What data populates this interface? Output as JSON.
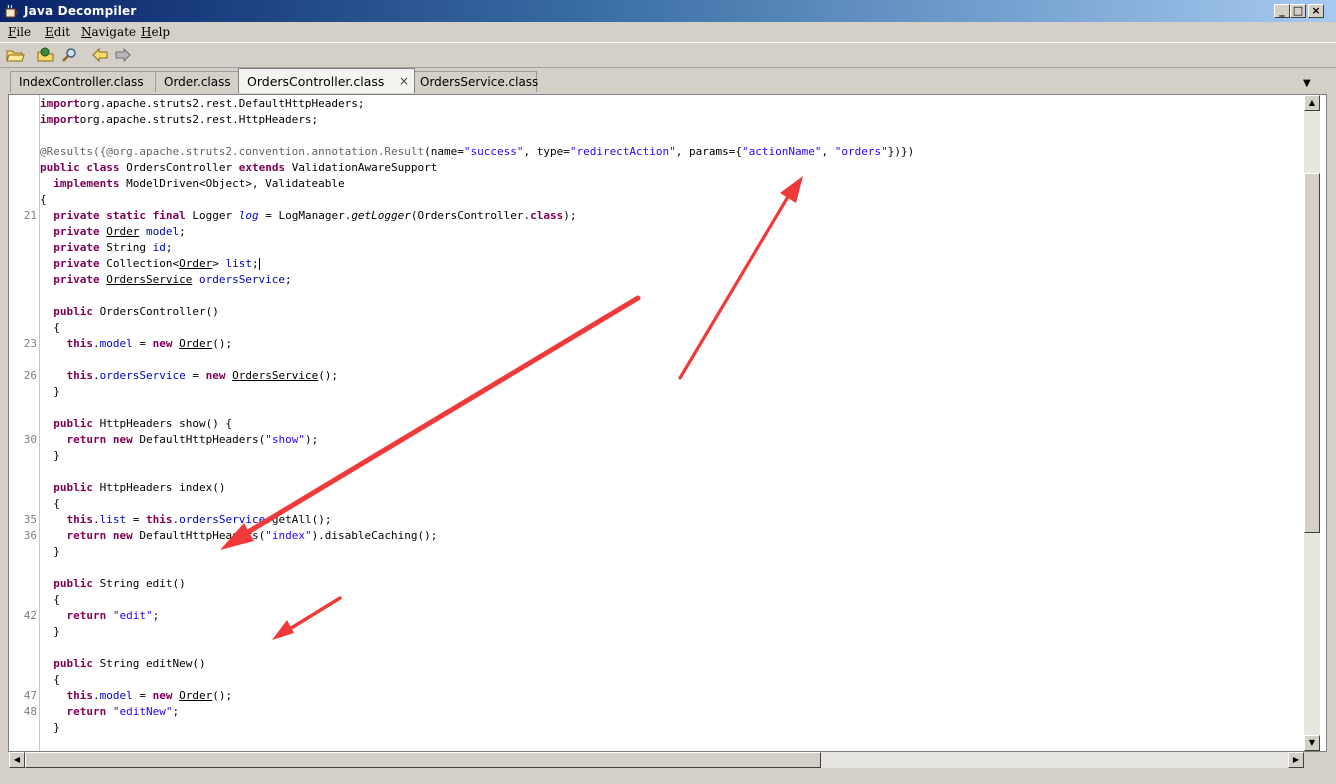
{
  "window": {
    "title": "Java Decompiler",
    "minimize_glyph": "_",
    "maximize_glyph": "□",
    "close_glyph": "×"
  },
  "menubar": [
    {
      "accel": "F",
      "rest": "ile"
    },
    {
      "accel": "E",
      "rest": "dit"
    },
    {
      "accel": "N",
      "rest": "avigate"
    },
    {
      "accel": "H",
      "rest": "elp"
    }
  ],
  "toolbar": {
    "icons": [
      "open-folder-icon",
      "open-type-icon",
      "search-icon",
      "back-icon",
      "forward-icon"
    ]
  },
  "tabs": [
    {
      "label": "IndexController.class",
      "active": false
    },
    {
      "label": "Order.class",
      "active": false
    },
    {
      "label": "OrdersController.class",
      "active": true,
      "close": "×"
    },
    {
      "label": "OrdersService.class",
      "active": false
    }
  ],
  "tab_menu_glyph": "▼",
  "code": {
    "line_numbers": [
      {
        "row": 7,
        "num": "21"
      },
      {
        "row": 15,
        "num": "23"
      },
      {
        "row": 17,
        "num": "26"
      },
      {
        "row": 21,
        "num": "30"
      },
      {
        "row": 26,
        "num": "35"
      },
      {
        "row": 27,
        "num": "36"
      },
      {
        "row": 32,
        "num": "42"
      },
      {
        "row": 37,
        "num": "47"
      },
      {
        "row": 38,
        "num": "48"
      }
    ],
    "lines": [
      [
        [
          "kw",
          "import"
        ],
        [
          "",
          "org.apache.struts2.rest.DefaultHttpHeaders;"
        ]
      ],
      [
        [
          "kw",
          "import"
        ],
        [
          "",
          "org.apache.struts2.rest.HttpHeaders;"
        ]
      ],
      [],
      [
        [
          "ann",
          "@Results({@org.apache.struts2.convention.annotation.Result"
        ],
        [
          "",
          "(name="
        ],
        [
          "str",
          "\"success\""
        ],
        [
          "",
          ", type="
        ],
        [
          "str",
          "\"redirectAction\""
        ],
        [
          "",
          ", params={"
        ],
        [
          "str",
          "\"actionName\""
        ],
        [
          "",
          ", "
        ],
        [
          "str",
          "\"orders\""
        ],
        [
          "",
          "})})"
        ]
      ],
      [
        [
          "kw",
          "public"
        ],
        [
          "",
          " "
        ],
        [
          "kw",
          "class"
        ],
        [
          "",
          " OrdersController "
        ],
        [
          "kw",
          "extends"
        ],
        [
          "",
          " ValidationAwareSupport"
        ]
      ],
      [
        [
          "",
          "  "
        ],
        [
          "kw",
          "implements"
        ],
        [
          "",
          " ModelDriven<Object>, Validateable"
        ]
      ],
      [
        [
          "",
          "{"
        ]
      ],
      [
        [
          "",
          "  "
        ],
        [
          "kw",
          "private"
        ],
        [
          "",
          " "
        ],
        [
          "kw",
          "static"
        ],
        [
          "",
          " "
        ],
        [
          "kw",
          "final"
        ],
        [
          "",
          " Logger "
        ],
        [
          "fld ital",
          "log"
        ],
        [
          "",
          " = LogManager."
        ],
        [
          "ital",
          "getLogger"
        ],
        [
          "",
          "(OrdersController."
        ],
        [
          "kw",
          "class"
        ],
        [
          "",
          ");"
        ]
      ],
      [
        [
          "",
          "  "
        ],
        [
          "kw",
          "private"
        ],
        [
          "",
          " "
        ],
        [
          "und",
          "Order"
        ],
        [
          "",
          " "
        ],
        [
          "fld",
          "model"
        ],
        [
          "",
          ";"
        ]
      ],
      [
        [
          "",
          "  "
        ],
        [
          "kw",
          "private"
        ],
        [
          "",
          " String "
        ],
        [
          "fld",
          "id"
        ],
        [
          "",
          ";"
        ]
      ],
      [
        [
          "",
          "  "
        ],
        [
          "kw",
          "private"
        ],
        [
          "",
          " Collection<"
        ],
        [
          "und",
          "Order"
        ],
        [
          "",
          "> "
        ],
        [
          "fld",
          "list"
        ],
        [
          "",
          ";"
        ],
        [
          "cursor",
          ""
        ]
      ],
      [
        [
          "",
          "  "
        ],
        [
          "kw",
          "private"
        ],
        [
          "",
          " "
        ],
        [
          "und",
          "OrdersService"
        ],
        [
          "",
          " "
        ],
        [
          "fld",
          "ordersService"
        ],
        [
          "",
          ";"
        ]
      ],
      [],
      [
        [
          "",
          "  "
        ],
        [
          "kw",
          "public"
        ],
        [
          "",
          " OrdersController()"
        ]
      ],
      [
        [
          "",
          "  {"
        ]
      ],
      [
        [
          "",
          "    "
        ],
        [
          "kw",
          "this"
        ],
        [
          "",
          "."
        ],
        [
          "fld",
          "model"
        ],
        [
          "",
          " = "
        ],
        [
          "kw",
          "new"
        ],
        [
          "",
          " "
        ],
        [
          "und",
          "Order"
        ],
        [
          "",
          "();"
        ]
      ],
      [],
      [
        [
          "",
          "    "
        ],
        [
          "kw",
          "this"
        ],
        [
          "",
          "."
        ],
        [
          "fld",
          "ordersService"
        ],
        [
          "",
          " = "
        ],
        [
          "kw",
          "new"
        ],
        [
          "",
          " "
        ],
        [
          "und",
          "OrdersService"
        ],
        [
          "",
          "();"
        ]
      ],
      [
        [
          "",
          "  }"
        ]
      ],
      [],
      [
        [
          "",
          "  "
        ],
        [
          "kw",
          "public"
        ],
        [
          "",
          " HttpHeaders show() {"
        ]
      ],
      [
        [
          "",
          "    "
        ],
        [
          "kw",
          "return"
        ],
        [
          "",
          " "
        ],
        [
          "kw",
          "new"
        ],
        [
          "",
          " DefaultHttpHeaders("
        ],
        [
          "str",
          "\"show\""
        ],
        [
          "",
          ");"
        ]
      ],
      [
        [
          "",
          "  }"
        ]
      ],
      [],
      [
        [
          "",
          "  "
        ],
        [
          "kw",
          "public"
        ],
        [
          "",
          " HttpHeaders index()"
        ]
      ],
      [
        [
          "",
          "  {"
        ]
      ],
      [
        [
          "",
          "    "
        ],
        [
          "kw",
          "this"
        ],
        [
          "",
          "."
        ],
        [
          "fld",
          "list"
        ],
        [
          "",
          " = "
        ],
        [
          "kw",
          "this"
        ],
        [
          "",
          "."
        ],
        [
          "fld",
          "ordersService"
        ],
        [
          "",
          ".getAll();"
        ]
      ],
      [
        [
          "",
          "    "
        ],
        [
          "kw",
          "return"
        ],
        [
          "",
          " "
        ],
        [
          "kw",
          "new"
        ],
        [
          "",
          " DefaultHttpHeaders("
        ],
        [
          "str",
          "\"index\""
        ],
        [
          "",
          ").disableCaching();"
        ]
      ],
      [
        [
          "",
          "  }"
        ]
      ],
      [],
      [
        [
          "",
          "  "
        ],
        [
          "kw",
          "public"
        ],
        [
          "",
          " String edit()"
        ]
      ],
      [
        [
          "",
          "  {"
        ]
      ],
      [
        [
          "",
          "    "
        ],
        [
          "kw",
          "return"
        ],
        [
          "",
          " "
        ],
        [
          "str",
          "\"edit\""
        ],
        [
          "",
          ";"
        ]
      ],
      [
        [
          "",
          "  }"
        ]
      ],
      [],
      [
        [
          "",
          "  "
        ],
        [
          "kw",
          "public"
        ],
        [
          "",
          " String editNew()"
        ]
      ],
      [
        [
          "",
          "  {"
        ]
      ],
      [
        [
          "",
          "    "
        ],
        [
          "kw",
          "this"
        ],
        [
          "",
          "."
        ],
        [
          "fld",
          "model"
        ],
        [
          "",
          " = "
        ],
        [
          "kw",
          "new"
        ],
        [
          "",
          " "
        ],
        [
          "und",
          "Order"
        ],
        [
          "",
          "();"
        ]
      ],
      [
        [
          "",
          "    "
        ],
        [
          "kw",
          "return"
        ],
        [
          "",
          " "
        ],
        [
          "str",
          "\"editNew\""
        ],
        [
          "",
          ";"
        ]
      ],
      [
        [
          "",
          "  }"
        ]
      ]
    ]
  },
  "scrollbars": {
    "up": "▲",
    "down": "▼",
    "left": "◀",
    "right": "▶"
  },
  "annotation_color": "#f03a3a"
}
